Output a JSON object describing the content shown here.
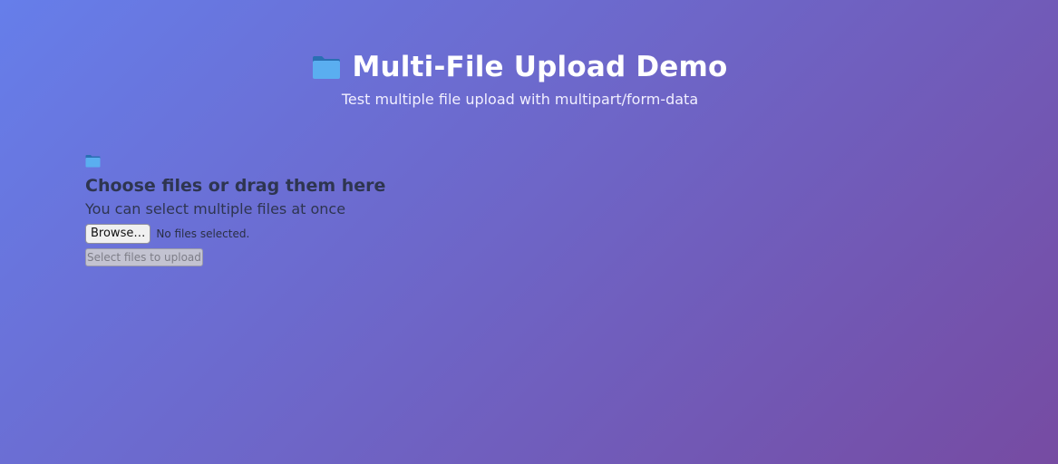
{
  "header": {
    "icon": "folder-icon",
    "title": "Multi-File Upload Demo",
    "subtitle": "Test multiple file upload with multipart/form-data"
  },
  "upload": {
    "icon": "folder-icon",
    "heading": "Choose files or drag them here",
    "hint": "You can select multiple files at once",
    "browse_label": "Browse…",
    "file_status": "No files selected.",
    "submit_label": "Select files to upload",
    "submit_disabled": true
  },
  "colors": {
    "background_start": "#667eea",
    "background_end": "#764ba2",
    "heading_text": "#2e3550",
    "folder_dark": "#2a6fb3",
    "folder_light": "#5aaef0"
  }
}
